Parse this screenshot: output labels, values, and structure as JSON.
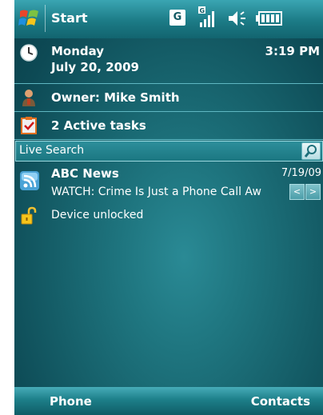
{
  "status_bar": {
    "start_label": "Start",
    "network_badge": "G",
    "icons": [
      "windows-flag-icon",
      "network-g-icon",
      "signal-icon",
      "volume-icon",
      "battery-icon"
    ]
  },
  "today": {
    "day": "Monday",
    "date": "July 20, 2009",
    "time": "3:19 PM",
    "owner": "Owner: Mike Smith",
    "tasks": "2 Active tasks"
  },
  "search": {
    "label": "Live Search"
  },
  "news": {
    "source": "ABC News",
    "date": "7/19/09",
    "headline": "WATCH: Crime Is Just a Phone Call Aw",
    "prev_label": "<",
    "next_label": ">"
  },
  "device": {
    "status": "Device unlocked"
  },
  "softkeys": {
    "left": "Phone",
    "right": "Contacts"
  },
  "colors": {
    "background": "#155e68",
    "divider": "#5fb7c2",
    "text": "#ffffff"
  }
}
